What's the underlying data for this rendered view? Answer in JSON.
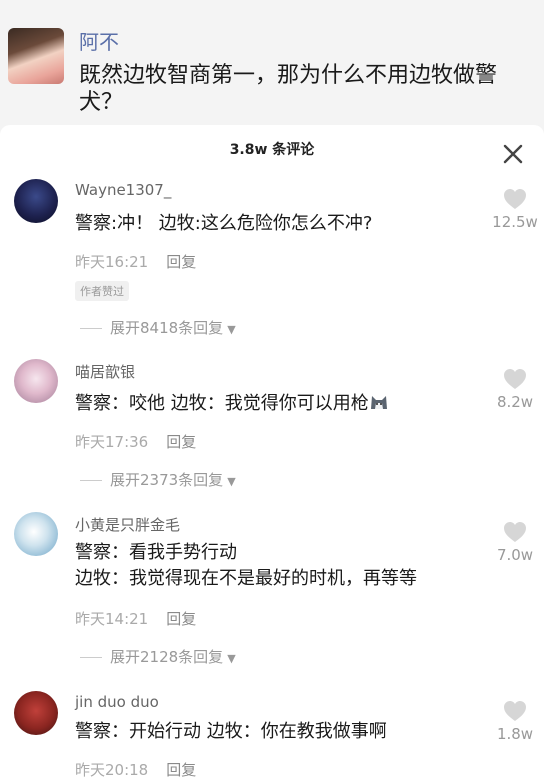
{
  "post": {
    "author": "阿不",
    "text": "既然边牧智商第一，那为什么不用边牧做警犬？"
  },
  "comments_header": {
    "count_label": "3.8w 条评论"
  },
  "comments": [
    {
      "username": "Wayne1307_",
      "text_lines": [
        "警察:冲！ 边牧:这么危险你怎么不冲?"
      ],
      "time": "昨天16:21",
      "reply_label": "回复",
      "badge": "作者赞过",
      "likes": "12.5w",
      "expand_label": "展开8418条回复"
    },
    {
      "username": "喵居歆银",
      "text_lines": [
        "警察：咬他 边牧：我觉得你可以用枪"
      ],
      "time": "昨天17:36",
      "reply_label": "回复",
      "likes": "8.2w",
      "expand_label": "展开2373条回复"
    },
    {
      "username": "小黄是只胖金毛",
      "text_lines": [
        "警察：看我手势行动",
        "边牧：我觉得现在不是最好的时机，再等等"
      ],
      "time": "昨天14:21",
      "reply_label": "回复",
      "likes": "7.0w",
      "expand_label": "展开2128条回复"
    },
    {
      "username": "jin duo duo",
      "text_lines": [
        "警察：开始行动 边牧：你在教我做事啊"
      ],
      "time": "昨天20:18",
      "reply_label": "回复",
      "likes": "1.8w"
    }
  ],
  "icons": {
    "close": "close-icon",
    "like": "heart-icon",
    "dropdown": "triangle-down-icon",
    "emoji": "husky-emoji-icon"
  }
}
